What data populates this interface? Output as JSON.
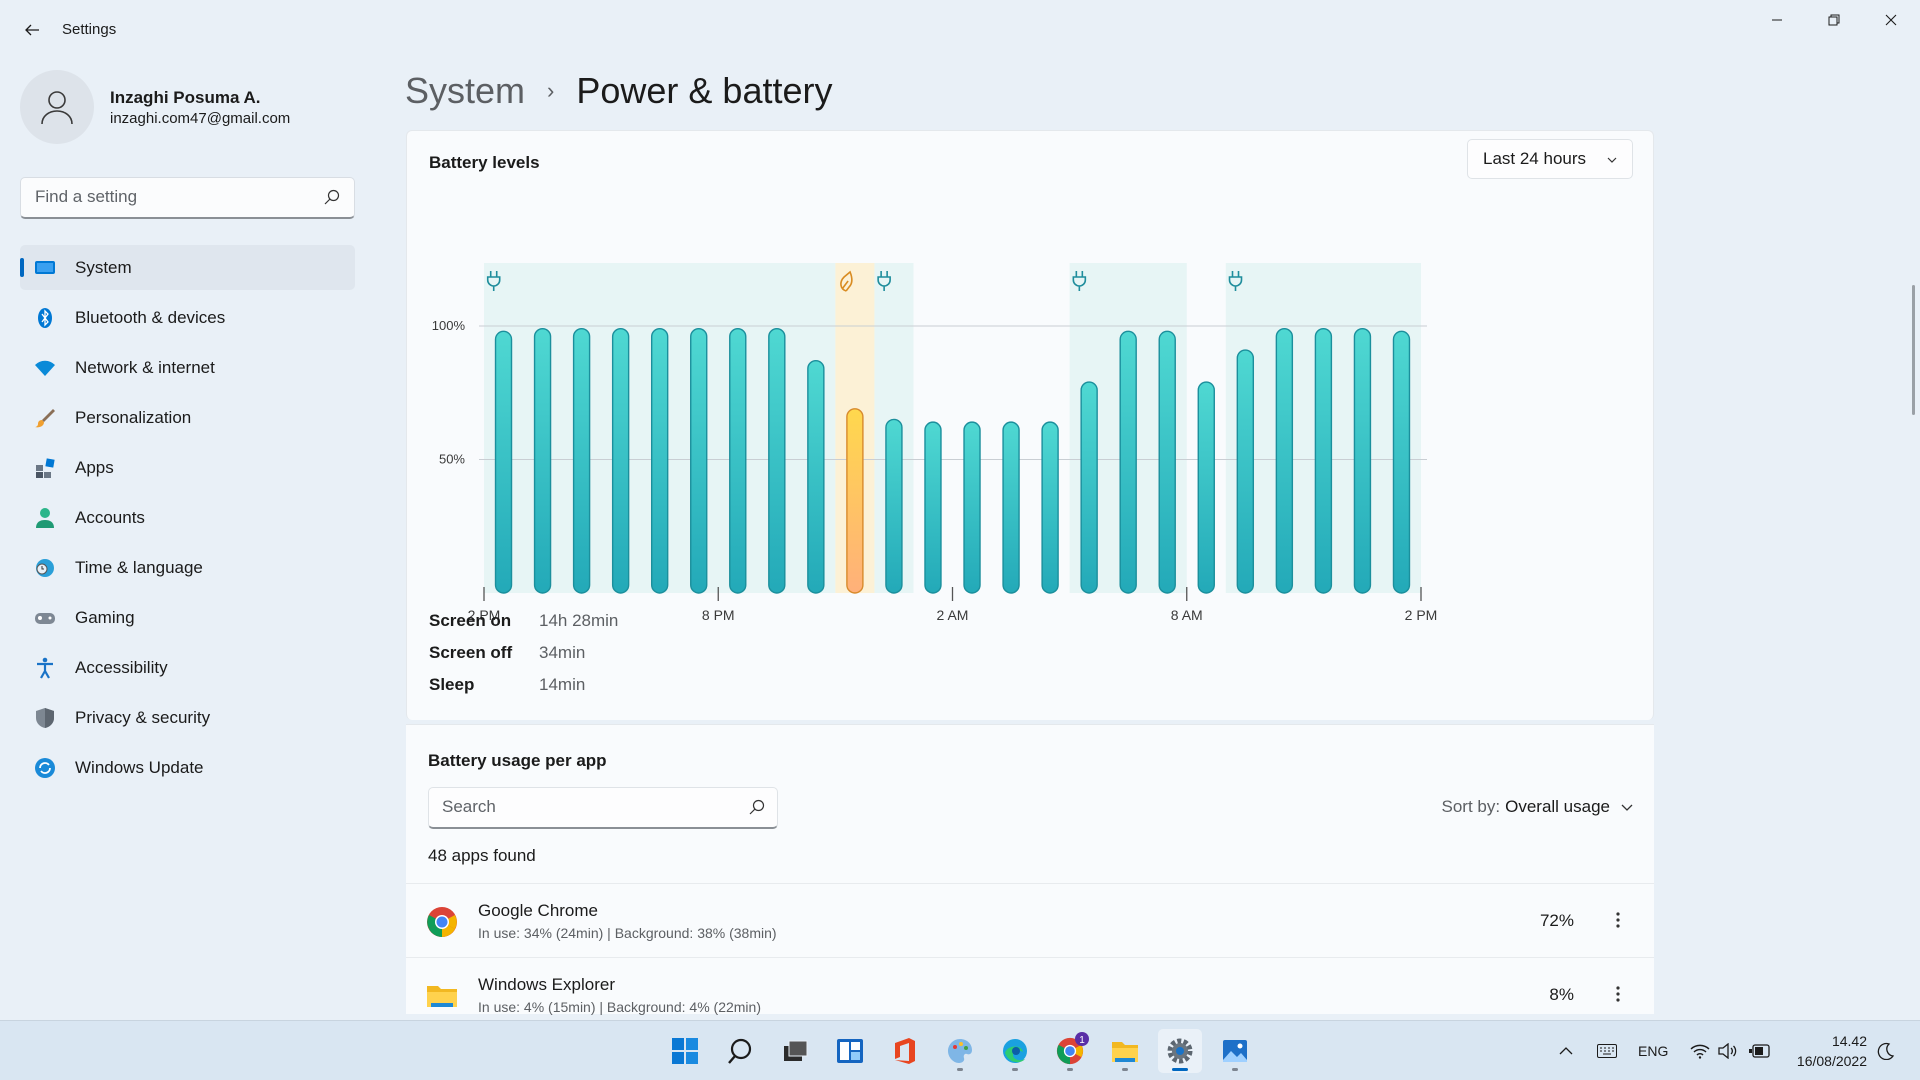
{
  "window": {
    "title": "Settings"
  },
  "profile": {
    "name": "Inzaghi Posuma A.",
    "email": "inzaghi.com47@gmail.com"
  },
  "search": {
    "placeholder": "Find a setting"
  },
  "sidebar": {
    "items": [
      {
        "label": "System",
        "icon": "monitor-icon",
        "selected": true
      },
      {
        "label": "Bluetooth & devices",
        "icon": "bluetooth-icon"
      },
      {
        "label": "Network & internet",
        "icon": "wifi-icon"
      },
      {
        "label": "Personalization",
        "icon": "brush-icon"
      },
      {
        "label": "Apps",
        "icon": "apps-icon"
      },
      {
        "label": "Accounts",
        "icon": "person-icon"
      },
      {
        "label": "Time & language",
        "icon": "globe-clock-icon"
      },
      {
        "label": "Gaming",
        "icon": "gamepad-icon"
      },
      {
        "label": "Accessibility",
        "icon": "accessibility-icon"
      },
      {
        "label": "Privacy & security",
        "icon": "shield-icon"
      },
      {
        "label": "Windows Update",
        "icon": "update-icon"
      }
    ]
  },
  "breadcrumb": {
    "parent": "System",
    "separator": "›",
    "current": "Power & battery"
  },
  "battery": {
    "title": "Battery levels",
    "range": "Last 24 hours",
    "stats": [
      {
        "label": "Screen on",
        "value": "14h 28min"
      },
      {
        "label": "Screen off",
        "value": "34min"
      },
      {
        "label": "Sleep",
        "value": "14min"
      }
    ]
  },
  "chart_data": {
    "type": "bar",
    "title": "Battery levels",
    "y_ticks": [
      "100%",
      "50%"
    ],
    "x_ticks": [
      "2 PM",
      "8 PM",
      "2 AM",
      "8 AM",
      "2 PM"
    ],
    "ylim": [
      0,
      100
    ],
    "grid": true,
    "colors": {
      "normal": "#2ec4c4",
      "saver": "#f5c242",
      "charging_band": "#d8f1ef",
      "saver_band": "#fcefd2"
    },
    "bars": [
      {
        "value": 98,
        "mode": "normal"
      },
      {
        "value": 99,
        "mode": "normal"
      },
      {
        "value": 99,
        "mode": "normal"
      },
      {
        "value": 99,
        "mode": "normal"
      },
      {
        "value": 99,
        "mode": "normal"
      },
      {
        "value": 99,
        "mode": "normal"
      },
      {
        "value": 99,
        "mode": "normal"
      },
      {
        "value": 99,
        "mode": "normal"
      },
      {
        "value": 87,
        "mode": "normal"
      },
      {
        "value": 69,
        "mode": "saver"
      },
      {
        "value": 65,
        "mode": "normal"
      },
      {
        "value": 64,
        "mode": "normal"
      },
      {
        "value": 64,
        "mode": "normal"
      },
      {
        "value": 64,
        "mode": "normal"
      },
      {
        "value": 64,
        "mode": "normal"
      },
      {
        "value": 79,
        "mode": "normal"
      },
      {
        "value": 98,
        "mode": "normal"
      },
      {
        "value": 98,
        "mode": "normal"
      },
      {
        "value": 79,
        "mode": "normal"
      },
      {
        "value": 91,
        "mode": "normal"
      },
      {
        "value": 99,
        "mode": "normal"
      },
      {
        "value": 99,
        "mode": "normal"
      },
      {
        "value": 99,
        "mode": "normal"
      },
      {
        "value": 98,
        "mode": "normal"
      }
    ],
    "charging_periods": [
      [
        0,
        9
      ],
      [
        10,
        11
      ],
      [
        15,
        18
      ],
      [
        19,
        24
      ]
    ],
    "saver_periods": [
      [
        9,
        10
      ]
    ],
    "markers": [
      {
        "at": 0.3,
        "icon": "plug-icon"
      },
      {
        "at": 9.3,
        "icon": "leaf-icon"
      },
      {
        "at": 10.3,
        "icon": "plug-icon"
      },
      {
        "at": 15.3,
        "icon": "plug-icon"
      },
      {
        "at": 19.3,
        "icon": "plug-icon"
      }
    ]
  },
  "usage": {
    "title": "Battery usage per app",
    "search_placeholder": "Search",
    "sort_label": "Sort by:",
    "sort_value": "Overall usage",
    "count": "48 apps found",
    "apps": [
      {
        "name": "Google Chrome",
        "detail": "In use: 34% (24min) | Background: 38% (38min)",
        "percent": "72%",
        "icon": "chrome-icon"
      },
      {
        "name": "Windows Explorer",
        "detail": "In use: 4% (15min) | Background: 4% (22min)",
        "percent": "8%",
        "icon": "folder-icon"
      }
    ]
  },
  "taskbar": {
    "icons": [
      "start-icon",
      "search-icon",
      "task-view-icon",
      "widgets-icon",
      "office-icon",
      "paint-icon",
      "edge-icon",
      "chrome-icon",
      "file-explorer-icon",
      "settings-icon",
      "photos-icon"
    ],
    "chrome_badge": "1",
    "language": "ENG",
    "time": "14.42",
    "date": "16/08/2022"
  }
}
